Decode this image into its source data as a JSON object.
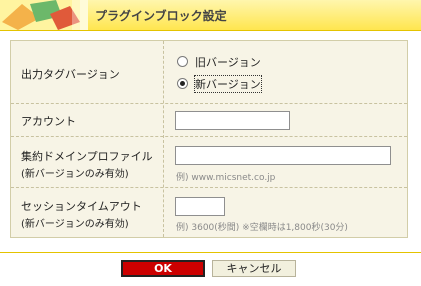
{
  "header": {
    "title": "プラグインブロック設定"
  },
  "form": {
    "version": {
      "label": "出力タグバージョン",
      "options": [
        "旧バージョン",
        "新バージョン"
      ],
      "selected": "新バージョン"
    },
    "account": {
      "label": "アカウント",
      "value": ""
    },
    "domain": {
      "label": "集約ドメインプロファイル",
      "note": "(新バージョンのみ有効)",
      "value": "",
      "hint": "例) www.micsnet.co.jp"
    },
    "timeout": {
      "label": "セッションタイムアウト",
      "note": "(新バージョンのみ有効)",
      "value": "",
      "hint": "例) 3600(秒間) ※空欄時は1,800秒(30分)"
    }
  },
  "buttons": {
    "ok": "OK",
    "cancel": "キャンセル"
  }
}
